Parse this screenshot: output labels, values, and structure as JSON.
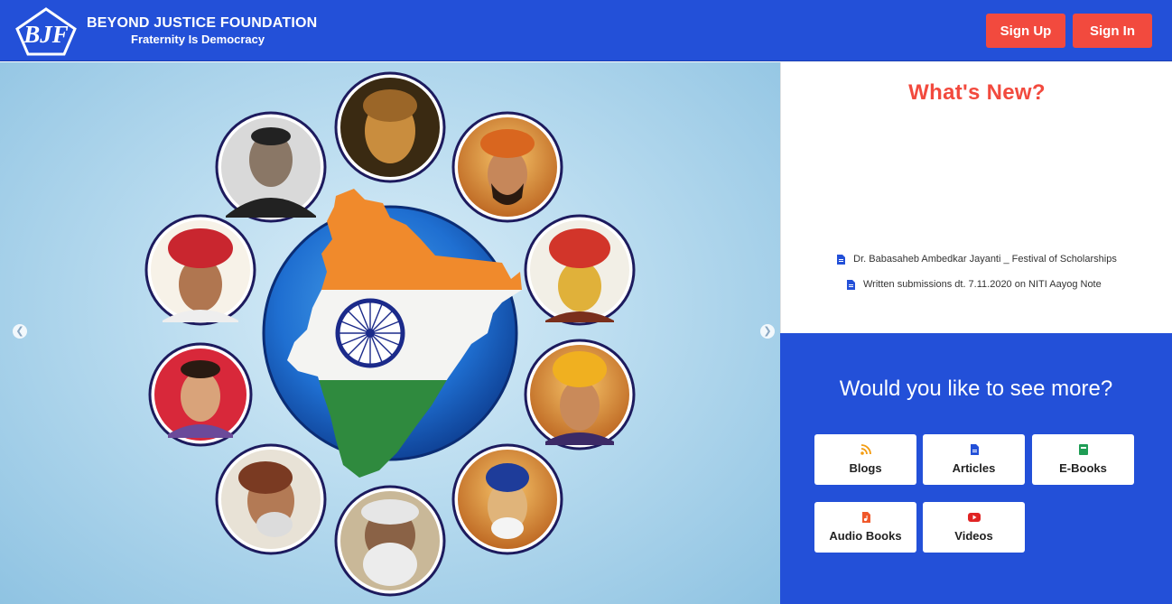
{
  "header": {
    "logo_text": "BJF",
    "brand_title": "BEYOND JUSTICE FOUNDATION",
    "brand_tagline": "Fraternity Is Democracy",
    "signup_label": "Sign Up",
    "signin_label": "Sign In"
  },
  "hero": {
    "prev_icon": "chevron-left-icon",
    "next_icon": "chevron-right-icon",
    "portrait_count": 10
  },
  "whats_new": {
    "title": "What's New?",
    "items": [
      "Dr. Babasaheb Ambedkar Jayanti _ Festival of Scholarships",
      "Written submissions dt. 7.11.2020 on NITI Aayog Note"
    ]
  },
  "see_more": {
    "title": "Would you like to see more?",
    "tiles": [
      {
        "label": "Blogs",
        "icon": "rss-icon"
      },
      {
        "label": "Articles",
        "icon": "document-icon"
      },
      {
        "label": "E-Books",
        "icon": "book-icon"
      },
      {
        "label": "Audio Books",
        "icon": "audio-file-icon"
      },
      {
        "label": "Videos",
        "icon": "youtube-icon"
      }
    ]
  },
  "colors": {
    "brand_blue": "#2350d8",
    "accent_red": "#f24a3e",
    "saffron": "#f08a2c",
    "india_green": "#2f8a3e",
    "chakra_navy": "#1b2a8a"
  }
}
